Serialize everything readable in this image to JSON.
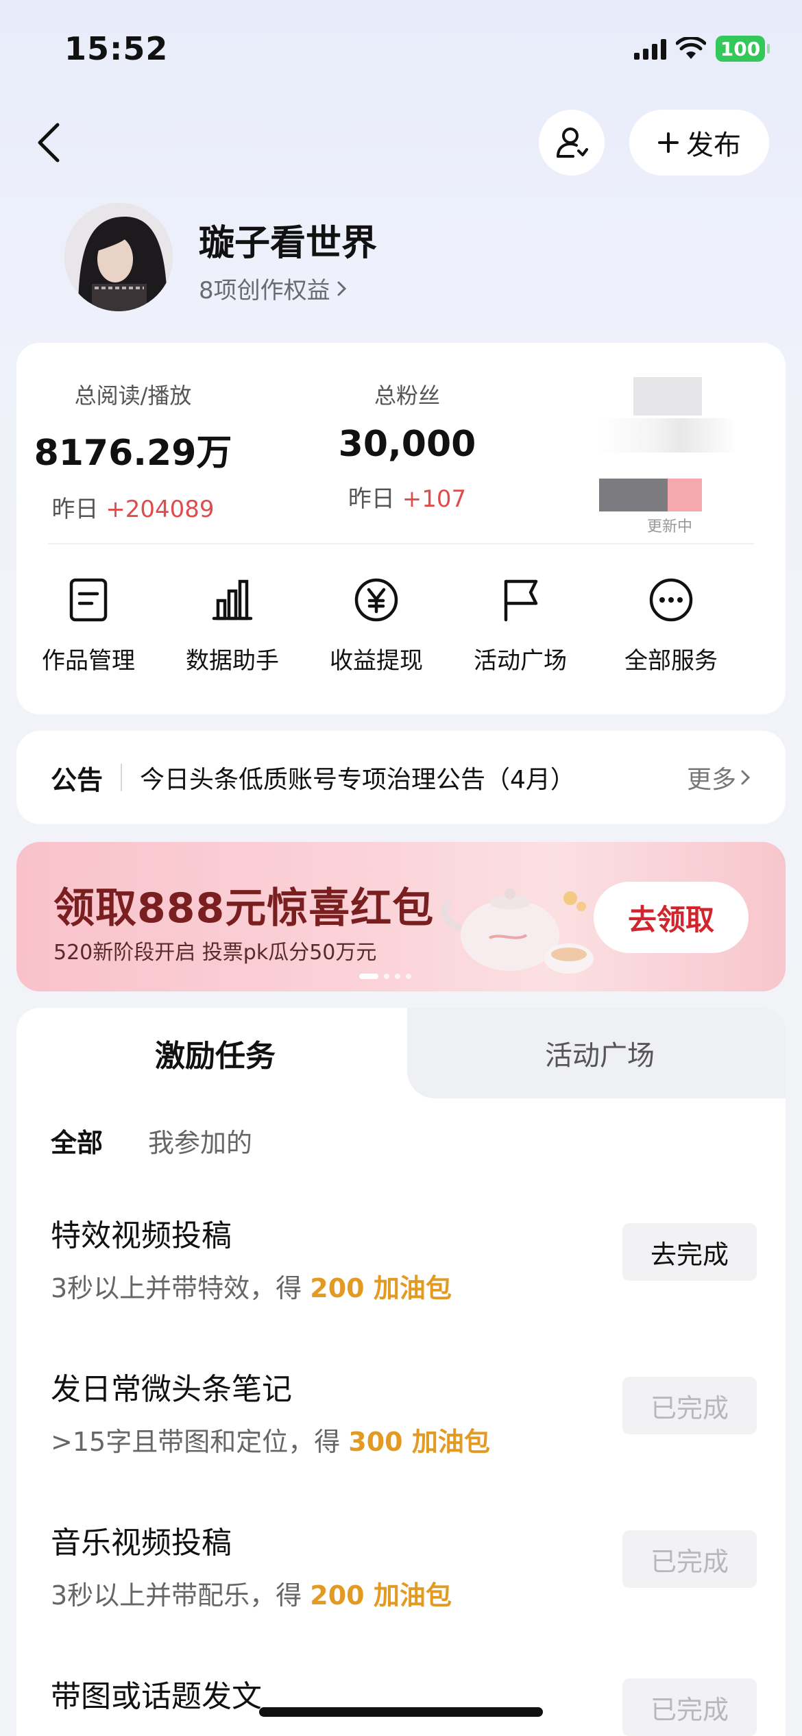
{
  "status_bar": {
    "time": "15:52",
    "battery": "100"
  },
  "header": {
    "publish_label": "发布"
  },
  "profile": {
    "name": "璇子看世界",
    "rights_text": "8项创作权益"
  },
  "stats": [
    {
      "label": "总阅读/播放",
      "value": "8176.29万",
      "delta_prefix": "昨日",
      "delta": "+204089"
    },
    {
      "label": "总粉丝",
      "value": "30,000",
      "delta_prefix": "昨日",
      "delta": "+107"
    }
  ],
  "stats_updating": "更新中",
  "services": [
    {
      "label": "作品管理",
      "icon": "document-icon"
    },
    {
      "label": "数据助手",
      "icon": "bar-chart-icon"
    },
    {
      "label": "收益提现",
      "icon": "yuan-icon"
    },
    {
      "label": "活动广场",
      "icon": "flag-icon"
    },
    {
      "label": "全部服务",
      "icon": "more-icon"
    }
  ],
  "notice": {
    "tag": "公告",
    "text": "今日头条低质账号专项治理公告（4月）",
    "more": "更多"
  },
  "banner": {
    "title": "领取888元惊喜红包",
    "subtitle": "520新阶段开启 投票pk瓜分50万元",
    "button": "去领取"
  },
  "tabs": {
    "active": "激励任务",
    "inactive": "活动广场"
  },
  "filters": {
    "all": "全部",
    "mine": "我参加的"
  },
  "tasks": [
    {
      "title": "特效视频投稿",
      "desc": "3秒以上并带特效，得 ",
      "reward": "200 加油包",
      "button": "去完成",
      "state": "todo"
    },
    {
      "title": "发日常微头条笔记",
      "desc": ">15字且带图和定位，得 ",
      "reward": "300 加油包",
      "button": "已完成",
      "state": "done"
    },
    {
      "title": "音乐视频投稿",
      "desc": "3秒以上并带配乐，得 ",
      "reward": "200 加油包",
      "button": "已完成",
      "state": "done"
    },
    {
      "title": "带图或话题发文",
      "desc": "",
      "reward": "",
      "button": "已完成",
      "state": "done"
    }
  ],
  "colors": {
    "accent_red": "#e04b4b",
    "reward_orange": "#e39a23",
    "banner_title": "#7a1f1f",
    "banner_button_text": "#d2242c"
  }
}
